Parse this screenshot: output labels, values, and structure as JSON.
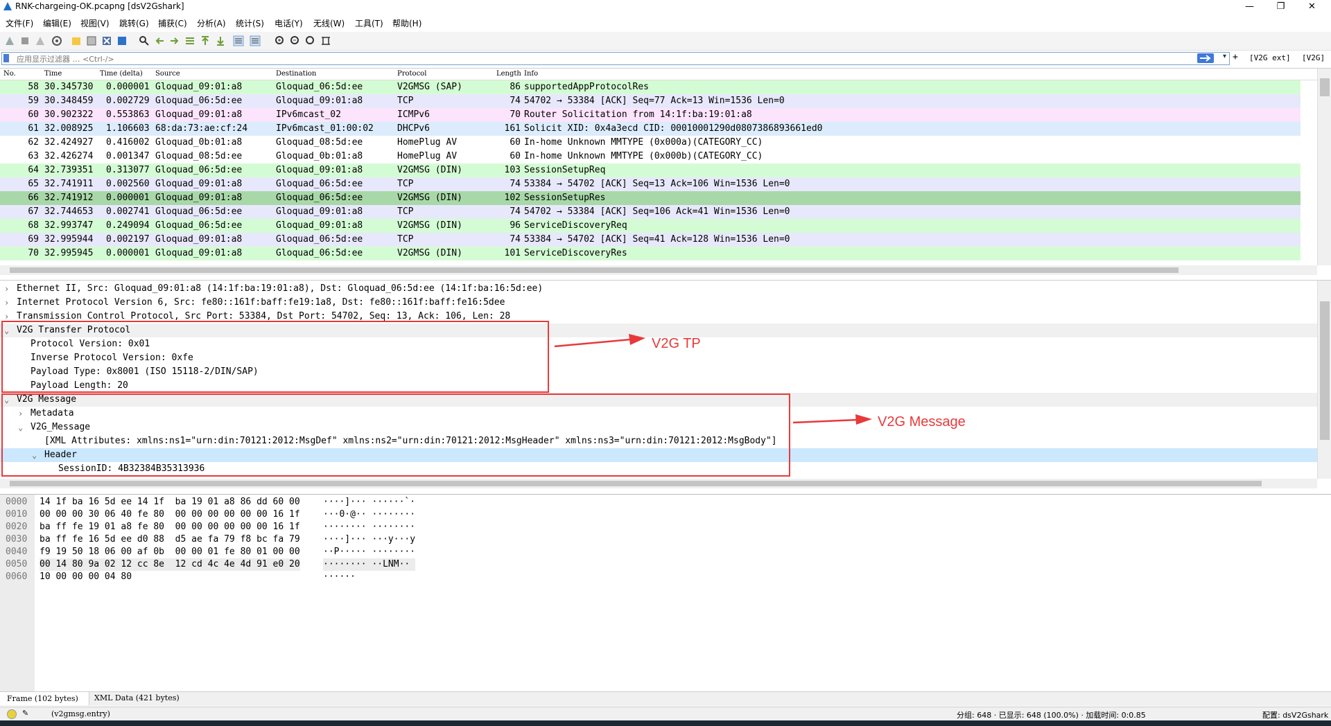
{
  "window": {
    "title": "RNK-chargeing-OK.pcapng [dsV2Gshark]",
    "minimize": "—",
    "maximize": "❐",
    "close": "✕"
  },
  "menu": [
    "文件(F)",
    "编辑(E)",
    "视图(V)",
    "跳转(G)",
    "捕获(C)",
    "分析(A)",
    "统计(S)",
    "电话(Y)",
    "无线(W)",
    "工具(T)",
    "帮助(H)"
  ],
  "filter": {
    "placeholder": "应用显示过滤器 … <Ctrl-/>",
    "plus": "+",
    "btn1": "[V2G ext]",
    "btn2": "[V2G]"
  },
  "packet_list": {
    "columns": [
      "No.",
      "Time",
      "Time (delta)",
      "Source",
      "Destination",
      "Protocol",
      "Length",
      "Info"
    ],
    "rows": [
      {
        "no": "58",
        "time": "30.345730",
        "delta": "0.000001",
        "src": "Gloquad_09:01:a8",
        "dst": "Gloquad_06:5d:ee",
        "proto": "V2GMSG (SAP)",
        "len": "86",
        "info": "supportedAppProtocolRes",
        "bg": "#d4fcd4"
      },
      {
        "no": "59",
        "time": "30.348459",
        "delta": "0.002729",
        "src": "Gloquad_06:5d:ee",
        "dst": "Gloquad_09:01:a8",
        "proto": "TCP",
        "len": "74",
        "info": "54702 → 53384 [ACK] Seq=77 Ack=13 Win=1536 Len=0",
        "bg": "#e8e8fc"
      },
      {
        "no": "60",
        "time": "30.902322",
        "delta": "0.553863",
        "src": "Gloquad_09:01:a8",
        "dst": "IPv6mcast_02",
        "proto": "ICMPv6",
        "len": "70",
        "info": "Router Solicitation from 14:1f:ba:19:01:a8",
        "bg": "#fce4fc"
      },
      {
        "no": "61",
        "time": "32.008925",
        "delta": "1.106603",
        "src": "68:da:73:ae:cf:24",
        "dst": "IPv6mcast_01:00:02",
        "proto": "DHCPv6",
        "len": "161",
        "info": "Solicit XID: 0x4a3ecd CID: 00010001290d0807386893661ed0",
        "bg": "#dcecfc"
      },
      {
        "no": "62",
        "time": "32.424927",
        "delta": "0.416002",
        "src": "Gloquad_0b:01:a8",
        "dst": "Gloquad_08:5d:ee",
        "proto": "HomePlug AV",
        "len": "60",
        "info": "In-home Unknown MMTYPE (0x000a)(CATEGORY_CC)",
        "bg": "#ffffff"
      },
      {
        "no": "63",
        "time": "32.426274",
        "delta": "0.001347",
        "src": "Gloquad_08:5d:ee",
        "dst": "Gloquad_0b:01:a8",
        "proto": "HomePlug AV",
        "len": "60",
        "info": "In-home Unknown MMTYPE (0x000b)(CATEGORY_CC)",
        "bg": "#ffffff"
      },
      {
        "no": "64",
        "time": "32.739351",
        "delta": "0.313077",
        "src": "Gloquad_06:5d:ee",
        "dst": "Gloquad_09:01:a8",
        "proto": "V2GMSG (DIN)",
        "len": "103",
        "info": "SessionSetupReq",
        "bg": "#d4fcd4"
      },
      {
        "no": "65",
        "time": "32.741911",
        "delta": "0.002560",
        "src": "Gloquad_09:01:a8",
        "dst": "Gloquad_06:5d:ee",
        "proto": "TCP",
        "len": "74",
        "info": "53384 → 54702 [ACK] Seq=13 Ack=106 Win=1536 Len=0",
        "bg": "#e8e8fc"
      },
      {
        "no": "66",
        "time": "32.741912",
        "delta": "0.000001",
        "src": "Gloquad_09:01:a8",
        "dst": "Gloquad_06:5d:ee",
        "proto": "V2GMSG (DIN)",
        "len": "102",
        "info": "SessionSetupRes",
        "bg": "#a8d8a8"
      },
      {
        "no": "67",
        "time": "32.744653",
        "delta": "0.002741",
        "src": "Gloquad_06:5d:ee",
        "dst": "Gloquad_09:01:a8",
        "proto": "TCP",
        "len": "74",
        "info": "54702 → 53384 [ACK] Seq=106 Ack=41 Win=1536 Len=0",
        "bg": "#e8e8fc"
      },
      {
        "no": "68",
        "time": "32.993747",
        "delta": "0.249094",
        "src": "Gloquad_06:5d:ee",
        "dst": "Gloquad_09:01:a8",
        "proto": "V2GMSG (DIN)",
        "len": "96",
        "info": "ServiceDiscoveryReq",
        "bg": "#d4fcd4"
      },
      {
        "no": "69",
        "time": "32.995944",
        "delta": "0.002197",
        "src": "Gloquad_09:01:a8",
        "dst": "Gloquad_06:5d:ee",
        "proto": "TCP",
        "len": "74",
        "info": "53384 → 54702 [ACK] Seq=41 Ack=128 Win=1536 Len=0",
        "bg": "#e8e8fc"
      },
      {
        "no": "70",
        "time": "32.995945",
        "delta": "0.000001",
        "src": "Gloquad_09:01:a8",
        "dst": "Gloquad_06:5d:ee",
        "proto": "V2GMSG (DIN)",
        "len": "101",
        "info": "ServiceDiscoveryRes",
        "bg": "#d4fcd4"
      }
    ]
  },
  "details": [
    {
      "text": "Ethernet II, Src: Gloquad_09:01:a8 (14:1f:ba:19:01:a8), Dst: Gloquad_06:5d:ee (14:1f:ba:16:5d:ee)",
      "indent": 0,
      "arrow": "›",
      "bg": "#ffffff"
    },
    {
      "text": "Internet Protocol Version 6, Src: fe80::161f:baff:fe19:1a8, Dst: fe80::161f:baff:fe16:5dee",
      "indent": 0,
      "arrow": "›",
      "bg": "#ffffff"
    },
    {
      "text": "Transmission Control Protocol, Src Port: 53384, Dst Port: 54702, Seq: 13, Ack: 106, Len: 28",
      "indent": 0,
      "arrow": "›",
      "bg": "#ffffff"
    },
    {
      "text": "V2G Transfer Protocol",
      "indent": 0,
      "arrow": "⌄",
      "bg": "#f0f0f0"
    },
    {
      "text": "Protocol Version: 0x01",
      "indent": 2,
      "arrow": "",
      "bg": "#ffffff"
    },
    {
      "text": "Inverse Protocol Version: 0xfe",
      "indent": 2,
      "arrow": "",
      "bg": "#ffffff"
    },
    {
      "text": "Payload Type: 0x8001 (ISO 15118-2/DIN/SAP)",
      "indent": 2,
      "arrow": "",
      "bg": "#ffffff"
    },
    {
      "text": "Payload Length: 20",
      "indent": 2,
      "arrow": "",
      "bg": "#ffffff"
    },
    {
      "text": "V2G Message",
      "indent": 0,
      "arrow": "⌄",
      "bg": "#f0f0f0"
    },
    {
      "text": "Metadata",
      "indent": 2,
      "arrow": "›",
      "bg": "#ffffff"
    },
    {
      "text": "V2G_Message",
      "indent": 2,
      "arrow": "⌄",
      "bg": "#ffffff"
    },
    {
      "text": "[XML Attributes:  xmlns:ns1=\"urn:din:70121:2012:MsgDef\" xmlns:ns2=\"urn:din:70121:2012:MsgHeader\" xmlns:ns3=\"urn:din:70121:2012:MsgBody\"]",
      "indent": 4,
      "arrow": "",
      "bg": "#ffffff"
    },
    {
      "text": "Header",
      "indent": 4,
      "arrow": "⌄",
      "bg": "#cce8ff"
    },
    {
      "text": "SessionID: 4B32384B35313936",
      "indent": 6,
      "arrow": "",
      "bg": "#ffffff"
    }
  ],
  "bytes": [
    {
      "offset": "0000",
      "hex": "14 1f ba 16 5d ee 14 1f  ba 19 01 a8 86 dd 60 00",
      "ascii": "····]··· ······`·"
    },
    {
      "offset": "0010",
      "hex": "00 00 00 30 06 40 fe 80  00 00 00 00 00 00 16 1f",
      "ascii": "···0·@·· ········"
    },
    {
      "offset": "0020",
      "hex": "ba ff fe 19 01 a8 fe 80  00 00 00 00 00 00 16 1f",
      "ascii": "········ ········"
    },
    {
      "offset": "0030",
      "hex": "ba ff fe 16 5d ee d0 88  d5 ae fa 79 f8 bc fa 79",
      "ascii": "····]··· ···y···y"
    },
    {
      "offset": "0040",
      "hex": "f9 19 50 18 06 00 af 0b  00 00 01 fe 80 01 00 00",
      "ascii": "··P····· ········"
    },
    {
      "offset": "0050",
      "hex": "00 14 80 9a 02 12 cc 8e  12 cd 4c 4e 4d 91 e0 20",
      "ascii": "········ ··LNM·· "
    },
    {
      "offset": "0060",
      "hex": "10 00 00 00 04 80",
      "ascii": "······"
    }
  ],
  "tabs": [
    "Frame (102 bytes)",
    "XML Data (421 bytes)"
  ],
  "status": {
    "field": "(v2gmsg.entry)",
    "packets": "分组: 648 · 已显示: 648 (100.0%) · 加载时间: 0:0.85",
    "profile": "配置: dsV2Gshark"
  },
  "annotations": {
    "tp_label": "V2G TP",
    "msg_label": "V2G Message",
    "color": "#e8393a"
  }
}
